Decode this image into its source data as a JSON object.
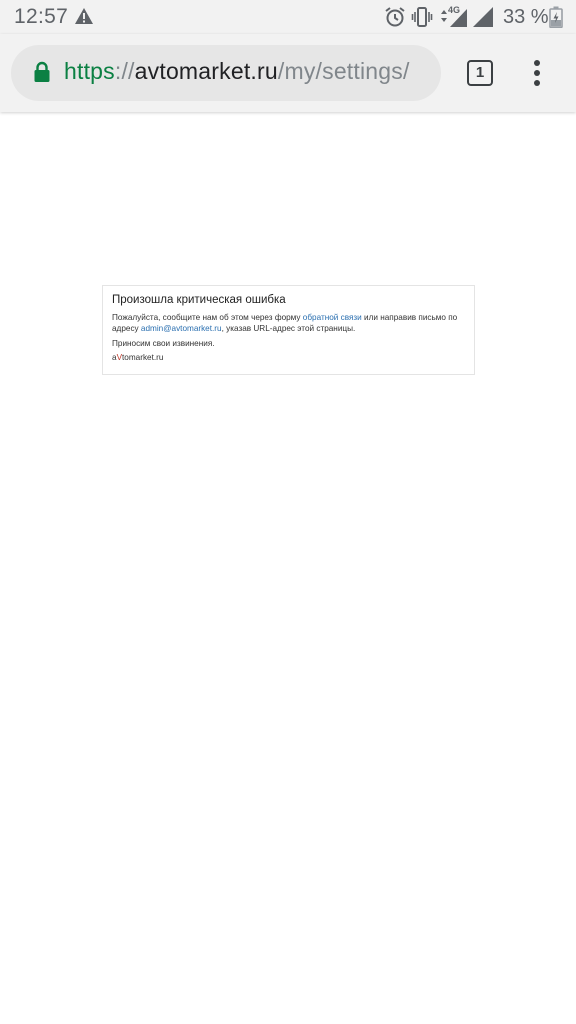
{
  "status_bar": {
    "time": "12:57",
    "network": "4G",
    "battery_percent": "33 %",
    "icons": [
      "warning-icon",
      "alarm-icon",
      "vibrate-icon",
      "mobile-data-icon",
      "signal-icon",
      "battery-icon"
    ]
  },
  "browser": {
    "url_scheme": "https",
    "url_separator": "://",
    "url_host": "avtomarket.ru",
    "url_path": "/my/settings/",
    "tab_count": "1",
    "colors": {
      "secure": "#0b8043",
      "toolbar": "#f2f2f2",
      "omnibox": "#e6e6e6"
    }
  },
  "error": {
    "title": "Произошла критическая ошибка",
    "line1_before": "Пожалуйста, сообщите нам об этом через форму ",
    "feedback_link": "обратной связи",
    "line1_middle": " или направив письмо по адресу ",
    "email_link": "admin@avtomarket.ru",
    "line1_after": ", указав URL-адрес этой страницы.",
    "apology": "Приносим свои извинения.",
    "brand_a": "a",
    "brand_v": "V",
    "brand_rest": "tomarket.ru"
  }
}
